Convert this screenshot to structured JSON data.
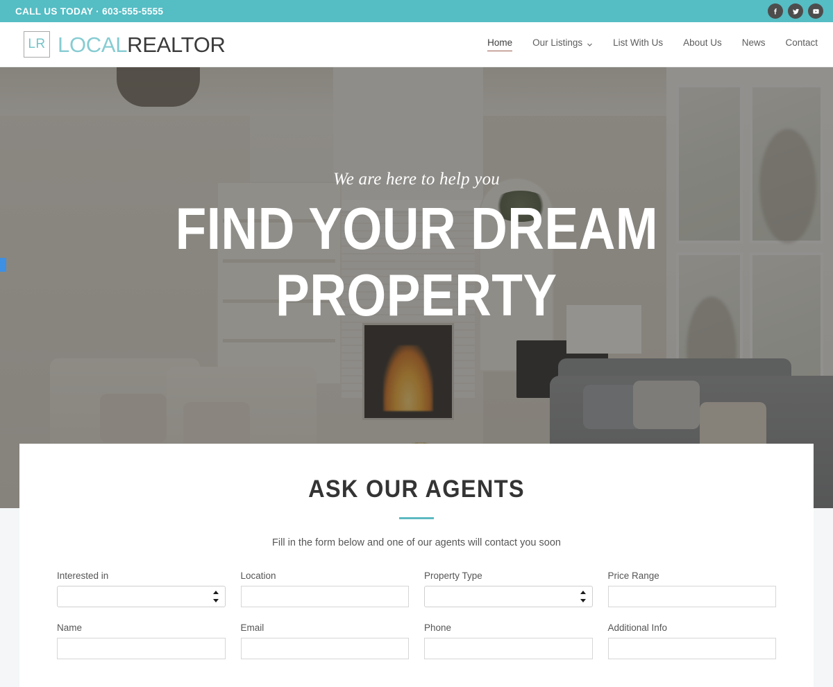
{
  "topbar": {
    "phone_label": "CALL US TODAY · 603-555-5555",
    "bg_color": "#55bdc4",
    "social": [
      {
        "name": "facebook",
        "label": "Facebook"
      },
      {
        "name": "twitter",
        "label": "Twitter"
      },
      {
        "name": "youtube",
        "label": "YouTube"
      }
    ]
  },
  "header": {
    "logo": {
      "monogram": "LR",
      "text_primary": "LOCAL",
      "text_secondary": "REALTOR",
      "primary_color": "#86ccd2",
      "secondary_color": "#3b3b3b"
    },
    "nav": [
      {
        "label": "Home",
        "active": true,
        "has_dropdown": false
      },
      {
        "label": "Our Listings",
        "active": false,
        "has_dropdown": true
      },
      {
        "label": "List With Us",
        "active": false,
        "has_dropdown": false
      },
      {
        "label": "About Us",
        "active": false,
        "has_dropdown": false
      },
      {
        "label": "News",
        "active": false,
        "has_dropdown": false
      },
      {
        "label": "Contact",
        "active": false,
        "has_dropdown": false
      }
    ],
    "active_underline_color": "#9c5f50"
  },
  "hero": {
    "eyebrow": "We are here to help you",
    "title_line1": "FIND YOUR DREAM",
    "title_line2": "PROPERTY",
    "overlay_color": "rgba(62,60,56,.55)",
    "slider_handle_color": "#3d90e3"
  },
  "form_section": {
    "title": "ASK OUR AGENTS",
    "divider_color": "#5cb9c2",
    "subtitle": "Fill in the form below and one of our agents will contact you soon",
    "fields": [
      {
        "label": "Interested in",
        "type": "select",
        "value": "",
        "placeholder": ""
      },
      {
        "label": "Location",
        "type": "text",
        "value": "",
        "placeholder": ""
      },
      {
        "label": "Property Type",
        "type": "select",
        "value": "",
        "placeholder": ""
      },
      {
        "label": "Price Range",
        "type": "text",
        "value": "",
        "placeholder": ""
      },
      {
        "label": "Name",
        "type": "text",
        "value": "",
        "placeholder": ""
      },
      {
        "label": "Email",
        "type": "text",
        "value": "",
        "placeholder": ""
      },
      {
        "label": "Phone",
        "type": "text",
        "value": "",
        "placeholder": ""
      },
      {
        "label": "Additional Info",
        "type": "text",
        "value": "",
        "placeholder": ""
      }
    ]
  }
}
